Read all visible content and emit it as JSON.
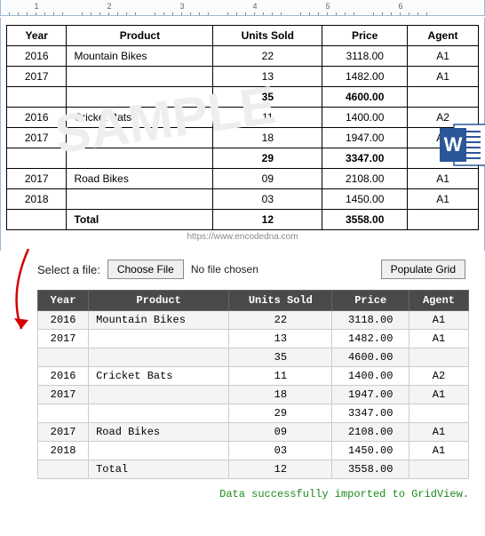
{
  "ruler_marks": [
    "1",
    "2",
    "3",
    "4",
    "5",
    "6"
  ],
  "watermark": "SAMPLE",
  "credit_url": "https://www.encodedna.com",
  "word_table": {
    "headers": [
      "Year",
      "Product",
      "Units Sold",
      "Price",
      "Agent"
    ],
    "rows": [
      {
        "year": "2016",
        "product": "Mountain Bikes",
        "units": "22",
        "price": "3118.00",
        "agent": "A1",
        "bold": false
      },
      {
        "year": "2017",
        "product": "",
        "units": "13",
        "price": "1482.00",
        "agent": "A1",
        "bold": false
      },
      {
        "year": "",
        "product": "",
        "units": "35",
        "price": "4600.00",
        "agent": "",
        "bold": true
      },
      {
        "year": "2016",
        "product": "Cricket Bats",
        "units": "11",
        "price": "1400.00",
        "agent": "A2",
        "bold": false
      },
      {
        "year": "2017",
        "product": "",
        "units": "18",
        "price": "1947.00",
        "agent": "A1",
        "bold": false
      },
      {
        "year": "",
        "product": "",
        "units": "29",
        "price": "3347.00",
        "agent": "",
        "bold": true
      },
      {
        "year": "2017",
        "product": "Road Bikes",
        "units": "09",
        "price": "2108.00",
        "agent": "A1",
        "bold": false
      },
      {
        "year": "2018",
        "product": "",
        "units": "03",
        "price": "1450.00",
        "agent": "A1",
        "bold": false
      },
      {
        "year": "",
        "product": "Total",
        "units": "12",
        "price": "3558.00",
        "agent": "",
        "bold": true
      }
    ]
  },
  "controls": {
    "select_label": "Select a file:",
    "choose_btn": "Choose File",
    "file_status": "No file chosen",
    "populate_btn": "Populate Grid"
  },
  "grid_table": {
    "headers": [
      "Year",
      "Product",
      "Units Sold",
      "Price",
      "Agent"
    ],
    "rows": [
      {
        "year": "2016",
        "product": "Mountain Bikes",
        "units": "22",
        "price": "3118.00",
        "agent": "A1"
      },
      {
        "year": "2017",
        "product": "",
        "units": "13",
        "price": "1482.00",
        "agent": "A1"
      },
      {
        "year": "",
        "product": "",
        "units": "35",
        "price": "4600.00",
        "agent": ""
      },
      {
        "year": "2016",
        "product": "Cricket Bats",
        "units": "11",
        "price": "1400.00",
        "agent": "A2"
      },
      {
        "year": "2017",
        "product": "",
        "units": "18",
        "price": "1947.00",
        "agent": "A1"
      },
      {
        "year": "",
        "product": "",
        "units": "29",
        "price": "3347.00",
        "agent": ""
      },
      {
        "year": "2017",
        "product": "Road Bikes",
        "units": "09",
        "price": "2108.00",
        "agent": "A1"
      },
      {
        "year": "2018",
        "product": "",
        "units": "03",
        "price": "1450.00",
        "agent": "A1"
      },
      {
        "year": "",
        "product": "Total",
        "units": "12",
        "price": "3558.00",
        "agent": ""
      }
    ]
  },
  "status_message": "Data successfully imported to GridView.",
  "colors": {
    "grid_header_bg": "#4a4a4a",
    "status_text": "#1a8a1a",
    "arrow": "#d40000",
    "word_blue": "#2b579a"
  }
}
